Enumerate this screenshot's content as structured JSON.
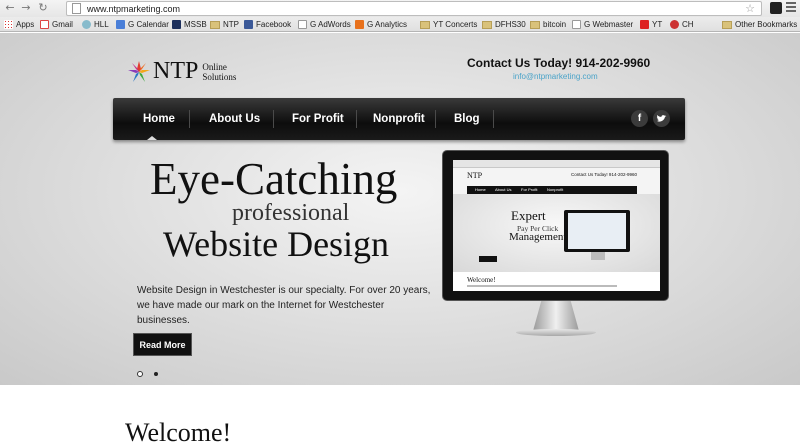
{
  "browser": {
    "url": "www.ntpmarketing.com",
    "bookmarks": [
      "Apps",
      "Gmail",
      "HLL",
      "G Calendar",
      "MSSB",
      "NTP",
      "Facebook",
      "G AdWords",
      "G Analytics",
      "YT Concerts",
      "DFHS30",
      "bitcoin",
      "G Webmaster",
      "YT",
      "CH",
      "Other Bookmarks"
    ]
  },
  "header": {
    "logo_name": "NTP",
    "logo_sub_1": "Online",
    "logo_sub_2": "Solutions",
    "contact": "Contact Us Today!  914-202-9960",
    "email": "info@ntpmarketing.com"
  },
  "nav": {
    "items": [
      "Home",
      "About Us",
      "For Profit",
      "Nonprofit",
      "Blog"
    ],
    "active": "Home",
    "social": [
      "f",
      "t"
    ]
  },
  "hero": {
    "line1": "Eye-Catching",
    "line2": "professional",
    "line3": "Website Design",
    "description": "Website Design in Westchester is our specialty. For over 20 years, we have made our mark on the Internet for Westchester businesses.",
    "cta": "Read More",
    "slides": 2,
    "active_slide": 1
  },
  "monitor_preview": {
    "logo": "NTP",
    "contact": "Contact Us Today! 914-202-9960",
    "nav": [
      "Home",
      "About Us",
      "For Profit",
      "Nonprofit"
    ],
    "line1": "Expert",
    "line2": "Pay Per Click",
    "line3": "Management",
    "welcome": "Welcome!"
  },
  "main": {
    "welcome": "Welcome!"
  },
  "colors": {
    "accent": "#4aa3c8",
    "nav_bg": "#111111"
  }
}
